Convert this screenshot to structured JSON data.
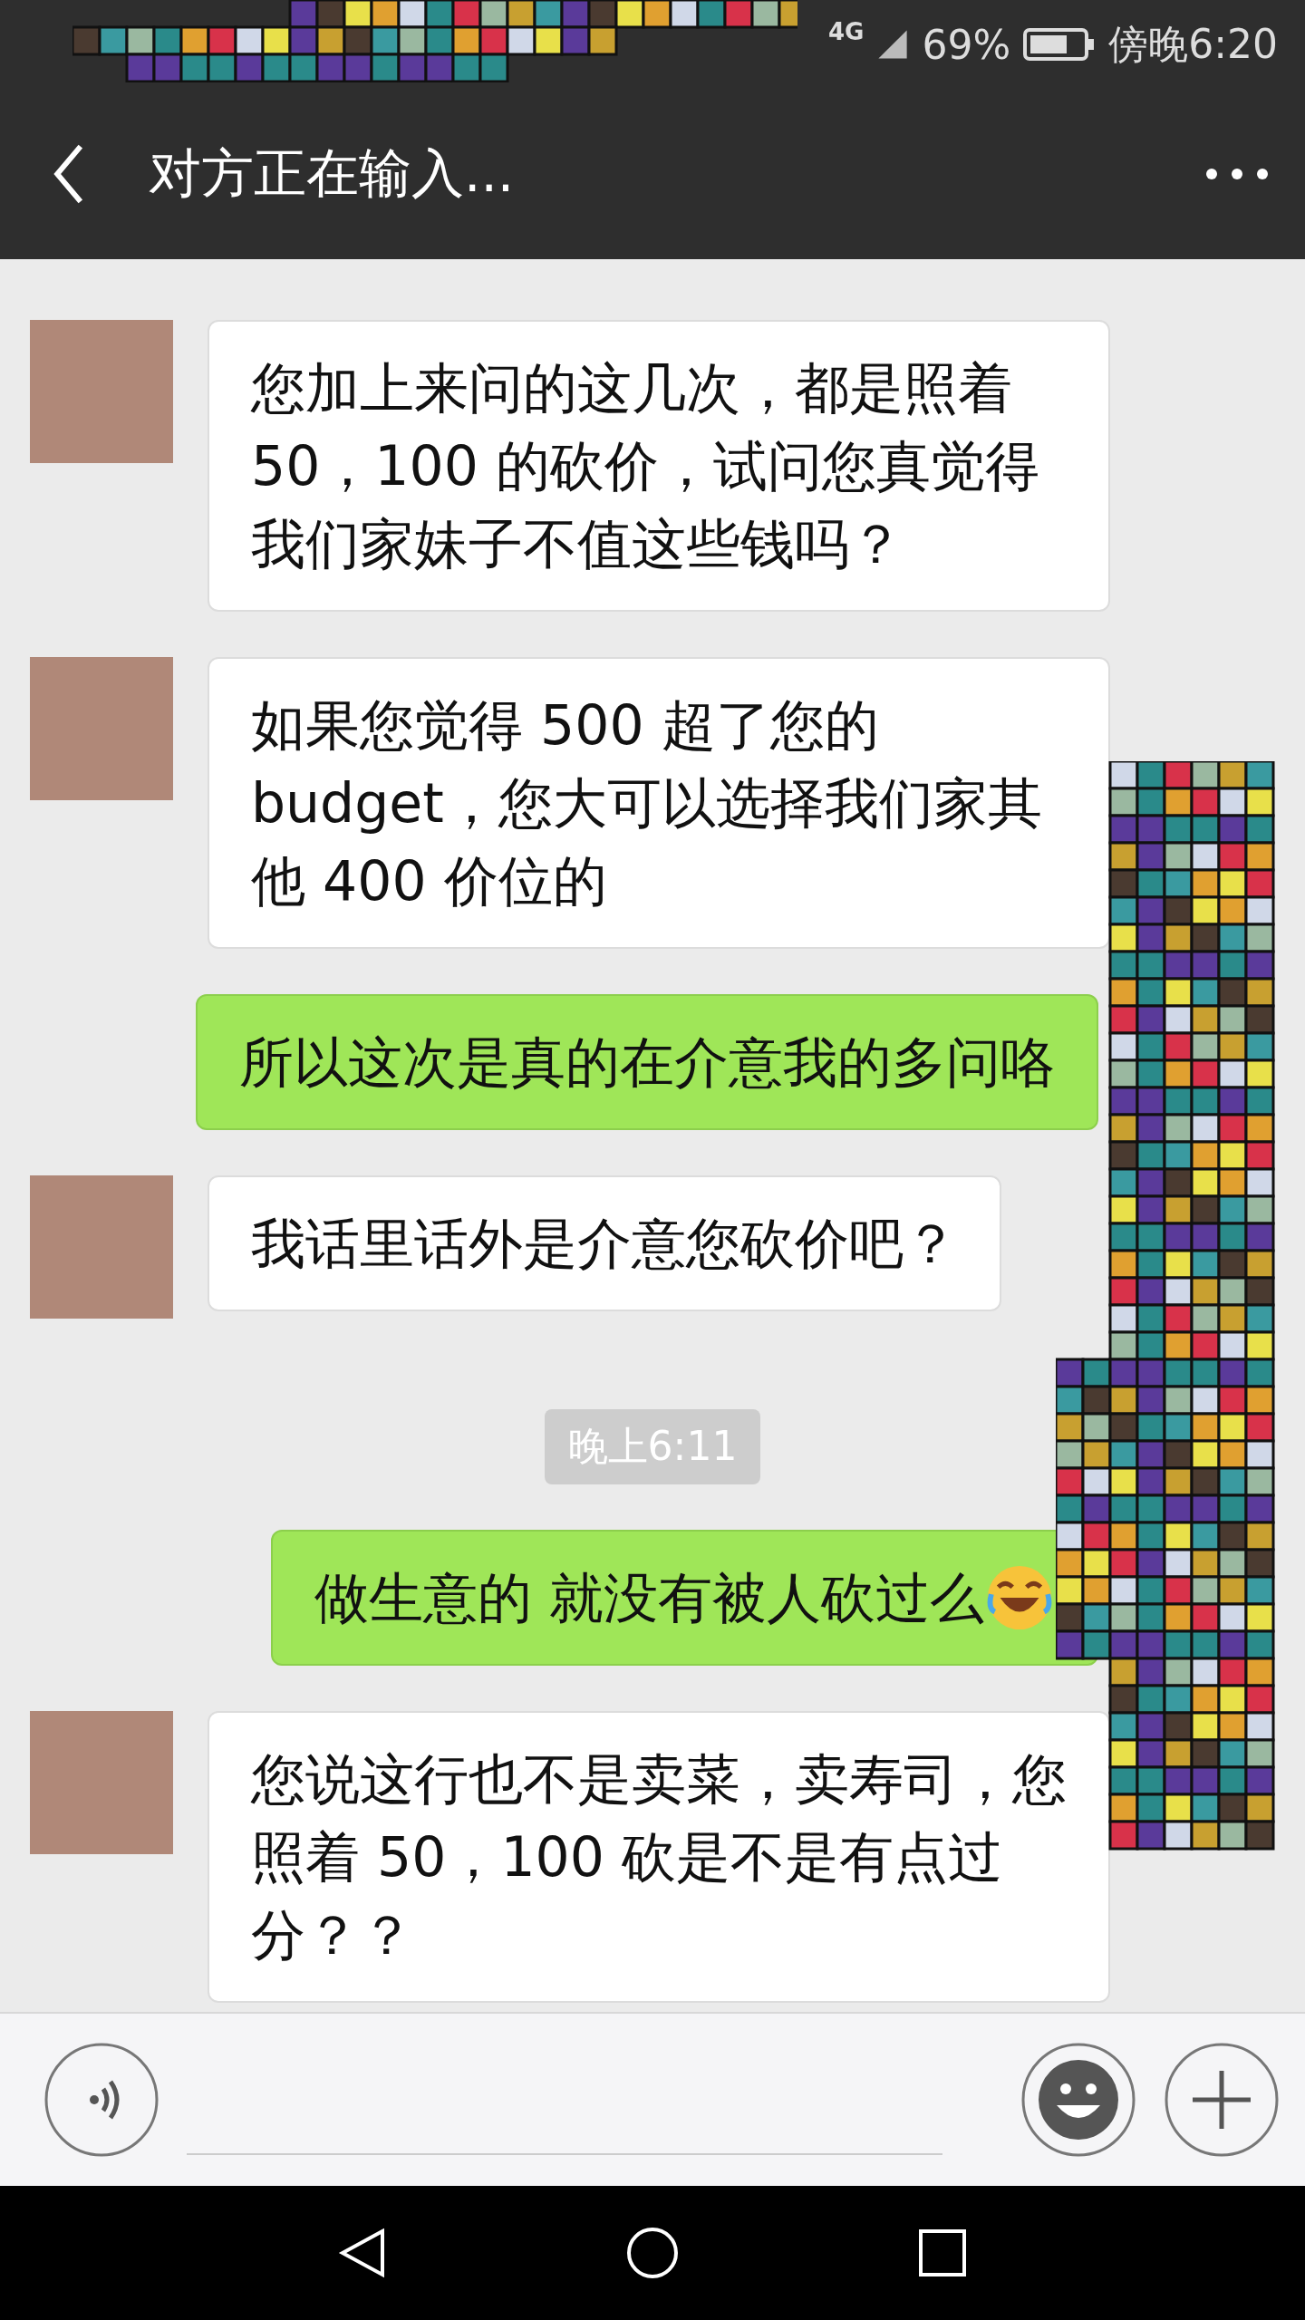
{
  "status_bar": {
    "network": "4G",
    "battery": "69%",
    "time": "傍晚6:20"
  },
  "header": {
    "title": "对方正在输入..."
  },
  "messages": [
    {
      "kind": "received",
      "text": "您加上来问的这几次，都是照着 50，100 的砍价，试问您真觉得我们家妹子不值这些钱吗？"
    },
    {
      "kind": "received",
      "text": "如果您觉得 500 超了您的 budget，您大可以选择我们家其他 400 价位的"
    },
    {
      "kind": "sent",
      "text": "所以这次是真的在介意我的多问咯",
      "emoji": false
    },
    {
      "kind": "received",
      "text": "我话里话外是介意您砍价吧？"
    },
    {
      "kind": "time",
      "text": "晚上6:11"
    },
    {
      "kind": "sent",
      "text": "做生意的 就没有被人砍过么",
      "emoji": true
    },
    {
      "kind": "received",
      "text": "您说这行也不是卖菜，卖寿司，您照着 50，100 砍是不是有点过分？？"
    }
  ]
}
